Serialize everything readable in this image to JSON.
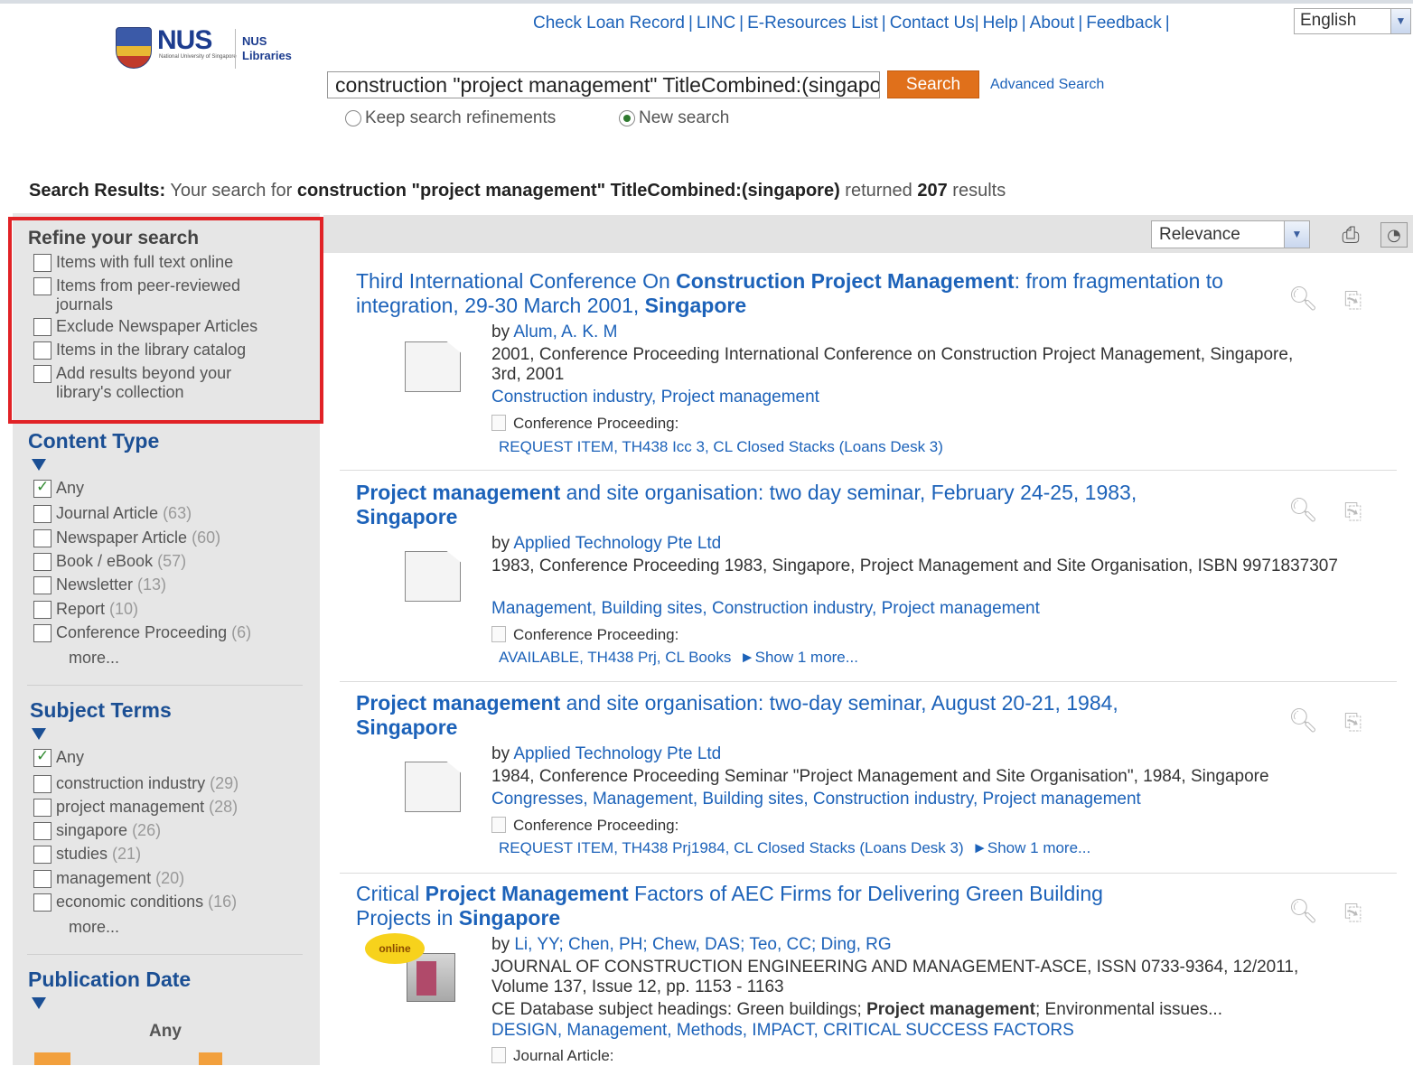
{
  "header": {
    "logo_text": "NUS",
    "logo_sub": "National University of Singapore",
    "libraries_label": "NUS Libraries",
    "nav": [
      "Check Loan Record",
      "LINC",
      "E-Resources List",
      "Contact Us",
      "Help",
      "About",
      "Feedback"
    ],
    "language": "English"
  },
  "search": {
    "query": "construction \"project management\" TitleCombined:(singapore)",
    "button": "Search",
    "advanced": "Advanced Search",
    "keep_refinements": "Keep search refinements",
    "new_search": "New search"
  },
  "summary": {
    "label": "Search Results:",
    "prefix": "Your search for",
    "query": "construction \"project management\" TitleCombined:(singapore)",
    "returned": "returned",
    "count": "207",
    "suffix": "results"
  },
  "sidebar": {
    "refine_title": "Refine your search",
    "refine_items": [
      "Items with full text online",
      "Items from peer-reviewed journals",
      "Exclude Newspaper Articles",
      "Items in the library catalog",
      "Add results beyond your library's collection"
    ],
    "content_type": {
      "title": "Content Type",
      "any": "Any",
      "items": [
        {
          "label": "Journal Article",
          "count": "(63)"
        },
        {
          "label": "Newspaper Article",
          "count": "(60)"
        },
        {
          "label": "Book / eBook",
          "count": "(57)"
        },
        {
          "label": "Newsletter",
          "count": "(13)"
        },
        {
          "label": "Report",
          "count": "(10)"
        },
        {
          "label": "Conference Proceeding",
          "count": "(6)"
        }
      ],
      "more": "more..."
    },
    "subject_terms": {
      "title": "Subject Terms",
      "any": "Any",
      "items": [
        {
          "label": "construction industry",
          "count": "(29)"
        },
        {
          "label": "project management",
          "count": "(28)"
        },
        {
          "label": "singapore",
          "count": "(26)"
        },
        {
          "label": "studies",
          "count": "(21)"
        },
        {
          "label": "management",
          "count": "(20)"
        },
        {
          "label": "economic conditions",
          "count": "(16)"
        }
      ],
      "more": "more..."
    },
    "publication_date": {
      "title": "Publication Date",
      "any": "Any"
    }
  },
  "toolbar": {
    "sort": "Relevance"
  },
  "results": [
    {
      "title_1": "Third International Conference On ",
      "title_b1": "Construction Project Management",
      "title_2": ": from fragmentation to integration, 29-30 March 2001, ",
      "title_b2": "Singapore",
      "by_prefix": "by ",
      "author": "Alum, A. K. M",
      "details": "2001, Conference Proceeding International Conference on Construction Project Management, Singapore, 3rd, 2001",
      "subjects": "Construction industry, Project management",
      "ctype": "Conference Proceeding:",
      "availability": "REQUEST ITEM, TH438 Icc 3, CL Closed Stacks (Loans Desk 3)"
    },
    {
      "title_b1": "Project management",
      "title_2": " and site organisation: two day seminar, February 24-25, 1983, ",
      "title_b2": "Singapore",
      "by_prefix": "by ",
      "author": "Applied Technology Pte Ltd",
      "details": "1983, Conference Proceeding 1983, Singapore, Project Management and Site Organisation, ISBN 9971837307",
      "subjects": "Management, Building sites, Construction industry, Project management",
      "ctype": "Conference Proceeding:",
      "availability": "AVAILABLE, TH438 Prj, CL Books",
      "show_more": "►Show 1 more..."
    },
    {
      "title_b1": "Project management",
      "title_2": " and site organisation: two-day seminar, August 20-21, 1984, ",
      "title_b2": "Singapore",
      "by_prefix": "by ",
      "author": "Applied Technology Pte Ltd",
      "details": "1984, Conference Proceeding Seminar \"Project Management and Site Organisation\", 1984, Singapore",
      "subjects": "Congresses, Management, Building sites, Construction industry, Project management",
      "ctype": "Conference Proceeding:",
      "availability": "REQUEST ITEM, TH438 Prj1984, CL Closed Stacks (Loans Desk 3)",
      "show_more": "►Show 1 more..."
    },
    {
      "title_1": "Critical ",
      "title_b1": "Project Management",
      "title_2": " Factors of AEC Firms for Delivering Green Building Projects in ",
      "title_b2": "Singapore",
      "by_prefix": "by ",
      "author": "Li, YY; Chen, PH; Chew, DAS; Teo, CC; Ding, RG",
      "details": "JOURNAL OF CONSTRUCTION ENGINEERING AND MANAGEMENT-ASCE, ISSN 0733-9364, 12/2011, Volume 137, Issue 12, pp. 1153 - 1163",
      "db_prefix": "CE Database subject headings: Green buildings; ",
      "db_bold": "Project management",
      "db_suffix": "; Environmental issues...",
      "subjects": "DESIGN, Management, Methods, IMPACT, CRITICAL SUCCESS FACTORS",
      "ctype": "Journal Article:",
      "badge": "online"
    }
  ],
  "colors": {
    "link": "#1c62b9",
    "search_button": "#e0701b",
    "highlight_border": "#e12226",
    "sidebar_bg": "#e6e6e6"
  }
}
